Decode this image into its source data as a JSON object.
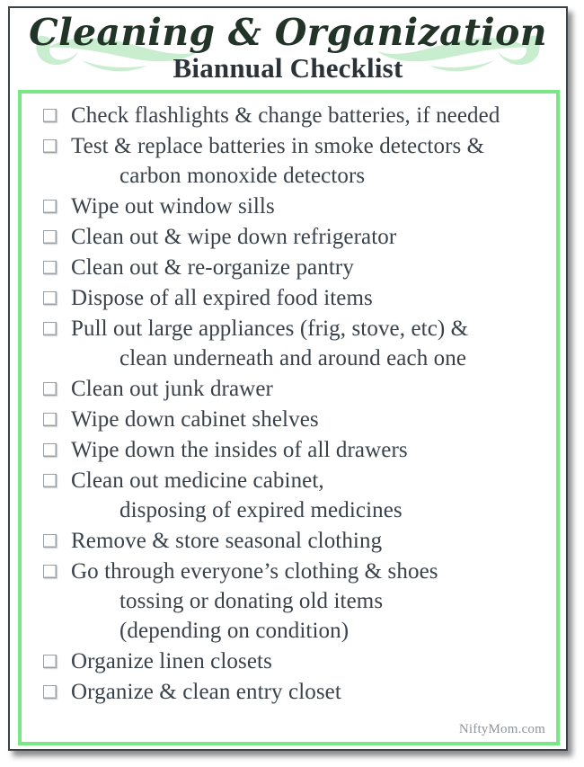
{
  "header": {
    "title_script": "Cleaning & Organization",
    "title_sub": "Biannual Checklist",
    "flourish_left_name": "decorative-flourish-left",
    "flourish_right_name": "decorative-flourish-right"
  },
  "colors": {
    "border_green": "#79e783",
    "flourish_green": "#c8edcf",
    "outer_frame": "#3a4248",
    "script_title": "#223328",
    "sub_title": "#2b3338",
    "item_text": "#39414a",
    "footer_text": "#8d949a"
  },
  "checklist": {
    "items": [
      {
        "lines": [
          "Check flashlights & change batteries, if needed"
        ],
        "checked": false
      },
      {
        "lines": [
          "Test & replace batteries in smoke detectors &",
          "carbon monoxide detectors"
        ],
        "checked": false
      },
      {
        "lines": [
          "Wipe out window sills"
        ],
        "checked": false
      },
      {
        "lines": [
          "Clean out & wipe down refrigerator"
        ],
        "checked": false
      },
      {
        "lines": [
          "Clean out & re-organize pantry"
        ],
        "checked": false
      },
      {
        "lines": [
          "Dispose of all expired food items"
        ],
        "checked": false
      },
      {
        "lines": [
          "Pull out large appliances (frig, stove, etc) &",
          "clean underneath and around each one"
        ],
        "checked": false
      },
      {
        "lines": [
          "Clean out junk drawer"
        ],
        "checked": false
      },
      {
        "lines": [
          "Wipe down cabinet shelves"
        ],
        "checked": false
      },
      {
        "lines": [
          "Wipe down the insides of all drawers"
        ],
        "checked": false
      },
      {
        "lines": [
          "Clean out medicine cabinet,",
          "disposing of expired medicines"
        ],
        "checked": false
      },
      {
        "lines": [
          "Remove & store seasonal clothing"
        ],
        "checked": false
      },
      {
        "lines": [
          "Go through everyone’s clothing & shoes",
          "tossing or donating old items",
          "(depending on condition)"
        ],
        "checked": false
      },
      {
        "lines": [
          "Organize linen closets"
        ],
        "checked": false
      },
      {
        "lines": [
          "Organize & clean entry closet"
        ],
        "checked": false
      }
    ]
  },
  "footer": {
    "credit": "NiftyMom.com"
  }
}
